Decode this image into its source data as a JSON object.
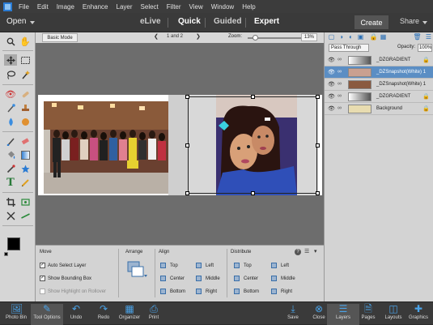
{
  "menubar": {
    "items": [
      "File",
      "Edit",
      "Image",
      "Enhance",
      "Layer",
      "Select",
      "Filter",
      "View",
      "Window",
      "Help"
    ]
  },
  "modebar": {
    "open_label": "Open",
    "modes": [
      "eLive",
      "Quick",
      "Guided",
      "Expert"
    ],
    "create_label": "Create",
    "share_label": "Share"
  },
  "optbar": {
    "basic_mode": "Basic Mode",
    "page_indicator": "1 and 2",
    "zoom_label": "Zoom:",
    "zoom_value": "13%",
    "zoom_fraction": 0.13
  },
  "tool_options": {
    "move_header": "Move",
    "auto_select": "Auto Select Layer",
    "show_bbox": "Show Bounding Box",
    "show_highlight": "Show Highlight on Rollover",
    "arrange_header": "Arrange",
    "align_header": "Align",
    "align_items": [
      "Top",
      "Left",
      "Center",
      "Middle",
      "Bottom",
      "Right"
    ],
    "distribute_header": "Distribute",
    "distribute_items": [
      "Top",
      "Left",
      "Center",
      "Middle",
      "Bottom",
      "Right"
    ]
  },
  "layers_panel": {
    "blend_mode": "Pass Through",
    "opacity_label": "Opacity:",
    "opacity_value": "100%",
    "layers": [
      {
        "name": "_DZGRADIENT",
        "selected": false,
        "locked": true
      },
      {
        "name": "_DZSnapshot(White) 1",
        "selected": true,
        "locked": false
      },
      {
        "name": "_DZSnapshot(White) 1",
        "selected": false,
        "locked": false
      },
      {
        "name": "_DZGRADIENT",
        "selected": false,
        "locked": true
      },
      {
        "name": "Background",
        "selected": false,
        "locked": true
      }
    ]
  },
  "taskbar": {
    "left": [
      "Photo Bin",
      "Tool Options",
      "Undo",
      "Redo",
      "Organizer",
      "Print"
    ],
    "right": [
      "Save",
      "Close",
      "Layers",
      "Pages",
      "Layouts",
      "Graphics"
    ]
  },
  "colors": {
    "accent": "#4aa3e8",
    "selected_layer": "#5b8ec4",
    "panel_bg": "#d3d3d3",
    "dark_chrome": "#3a3a3a"
  }
}
